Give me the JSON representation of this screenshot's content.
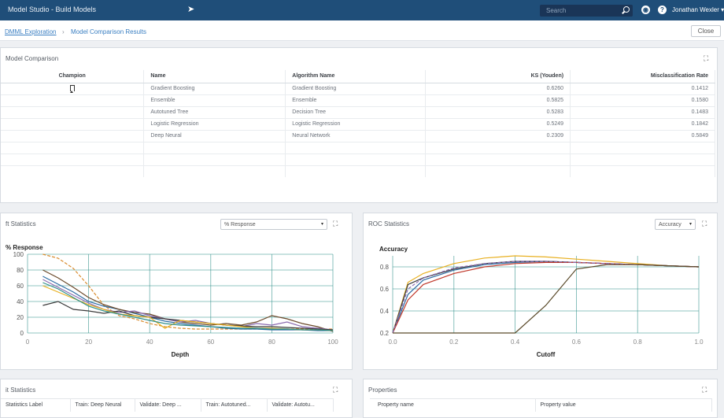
{
  "header": {
    "app_title": "Model Studio - Build Models",
    "search_placeholder": "Search",
    "user_name": "Jonathan Wexler ▾"
  },
  "breadcrumb": {
    "parent": "DMML Exploration",
    "separator": "›",
    "current": "Model Comparison Results",
    "close_label": "Close"
  },
  "model_comparison": {
    "title": "Model Comparison",
    "columns": [
      "Champion",
      "Name",
      "Algorithm Name",
      "KS (Youden)",
      "Misclassification Rate"
    ],
    "rows": [
      {
        "champion": true,
        "name": "Gradient Boosting",
        "algorithm": "Gradient Boosting",
        "ks": "0.6260",
        "misclass": "0.1412"
      },
      {
        "champion": false,
        "name": "Ensemble",
        "algorithm": "Ensemble",
        "ks": "0.5825",
        "misclass": "0.1580"
      },
      {
        "champion": false,
        "name": "Autotuned Tree",
        "algorithm": "Decision Tree",
        "ks": "0.5283",
        "misclass": "0.1483"
      },
      {
        "champion": false,
        "name": "Logistic Regression",
        "algorithm": "Logistic Regression",
        "ks": "0.5249",
        "misclass": "0.1842"
      },
      {
        "champion": false,
        "name": "Deep Neural",
        "algorithm": "Neural Network",
        "ks": "0.2309",
        "misclass": "0.5849"
      }
    ]
  },
  "lift_panel": {
    "title": "ft Statistics",
    "select_value": "% Response",
    "caret": "▾"
  },
  "roc_panel": {
    "title": "ROC Statistics",
    "select_value": "Accuracy",
    "caret": "▾"
  },
  "fit_panel": {
    "title": "it Statistics",
    "columns": [
      "Statistics Label",
      "Train: Deep Neural",
      "Validate: Deep ...",
      "Train: Autotuned...",
      "Validate: Autotu..."
    ]
  },
  "properties_panel": {
    "title": "Properties",
    "columns": [
      "Property name",
      "Property value"
    ]
  },
  "chart_data": [
    {
      "type": "line",
      "title": "% Response",
      "xlabel": "Depth",
      "ylabel": "% Response",
      "xlim": [
        0,
        100
      ],
      "ylim": [
        0,
        100
      ],
      "xticks": [
        0,
        20,
        40,
        60,
        80,
        100
      ],
      "yticks": [
        0,
        20,
        40,
        60,
        80,
        100
      ],
      "grid": true,
      "x": [
        5,
        10,
        15,
        20,
        25,
        30,
        35,
        40,
        45,
        50,
        55,
        60,
        65,
        70,
        75,
        80,
        85,
        90,
        95,
        100
      ],
      "series": [
        {
          "color": "#d98c2f",
          "dashed": true,
          "values": [
            100,
            95,
            82,
            60,
            35,
            22,
            18,
            12,
            8,
            6,
            5,
            5,
            5,
            5,
            5,
            5,
            5,
            5,
            5,
            5
          ]
        },
        {
          "color": "#2e6da4",
          "values": [
            72,
            62,
            52,
            40,
            34,
            30,
            25,
            20,
            15,
            12,
            10,
            8,
            6,
            5,
            5,
            4,
            4,
            4,
            3,
            3
          ]
        },
        {
          "color": "#6b4a2b",
          "values": [
            80,
            70,
            58,
            45,
            36,
            30,
            26,
            24,
            18,
            14,
            12,
            10,
            12,
            10,
            14,
            22,
            18,
            12,
            8,
            2
          ]
        },
        {
          "color": "#8b6bb0",
          "values": [
            68,
            58,
            48,
            38,
            30,
            26,
            28,
            22,
            18,
            14,
            16,
            12,
            10,
            8,
            12,
            10,
            14,
            8,
            6,
            4
          ]
        },
        {
          "color": "#3a3a3a",
          "values": [
            35,
            40,
            30,
            28,
            25,
            28,
            22,
            20,
            18,
            16,
            14,
            12,
            10,
            9,
            8,
            8,
            7,
            6,
            5,
            4
          ]
        },
        {
          "color": "#e8b020",
          "values": [
            60,
            52,
            44,
            36,
            30,
            24,
            22,
            20,
            6,
            16,
            14,
            12,
            10,
            8,
            6,
            6,
            5,
            4,
            4,
            3
          ]
        },
        {
          "color": "#2f8f8a",
          "values": [
            64,
            56,
            45,
            34,
            28,
            24,
            20,
            16,
            12,
            10,
            9,
            8,
            7,
            6,
            6,
            5,
            5,
            4,
            4,
            3
          ]
        }
      ]
    },
    {
      "type": "line",
      "title": "Accuracy",
      "xlabel": "Cutoff",
      "ylabel": "Accuracy",
      "xlim": [
        0,
        1
      ],
      "ylim": [
        0.2,
        0.9
      ],
      "xticks": [
        0.0,
        0.2,
        0.4,
        0.6,
        0.8,
        1.0
      ],
      "yticks": [
        0.2,
        0.4,
        0.6,
        0.8
      ],
      "grid": true,
      "x": [
        0.0,
        0.05,
        0.1,
        0.2,
        0.3,
        0.4,
        0.5,
        0.6,
        0.7,
        0.8,
        0.9,
        1.0
      ],
      "series": [
        {
          "color": "#e8b020",
          "values": [
            0.2,
            0.66,
            0.74,
            0.83,
            0.88,
            0.9,
            0.89,
            0.87,
            0.85,
            0.83,
            0.81,
            0.8
          ]
        },
        {
          "color": "#2e6da4",
          "values": [
            0.2,
            0.55,
            0.68,
            0.77,
            0.82,
            0.84,
            0.85,
            0.84,
            0.83,
            0.82,
            0.81,
            0.8
          ]
        },
        {
          "color": "#3a3a3a",
          "values": [
            0.2,
            0.64,
            0.7,
            0.78,
            0.83,
            0.85,
            0.85,
            0.84,
            0.83,
            0.82,
            0.81,
            0.8
          ]
        },
        {
          "color": "#c0392b",
          "values": [
            0.2,
            0.5,
            0.64,
            0.74,
            0.8,
            0.83,
            0.84,
            0.84,
            0.83,
            0.82,
            0.81,
            0.8
          ]
        },
        {
          "color": "#8b6bb0",
          "dashed": true,
          "values": [
            0.2,
            0.6,
            0.7,
            0.79,
            0.83,
            0.85,
            0.85,
            0.84,
            0.83,
            0.82,
            0.81,
            0.8
          ]
        },
        {
          "color": "#5a4a2a",
          "values": [
            0.2,
            0.2,
            0.2,
            0.2,
            0.2,
            0.2,
            0.45,
            0.78,
            0.82,
            0.82,
            0.81,
            0.8
          ]
        }
      ]
    }
  ]
}
